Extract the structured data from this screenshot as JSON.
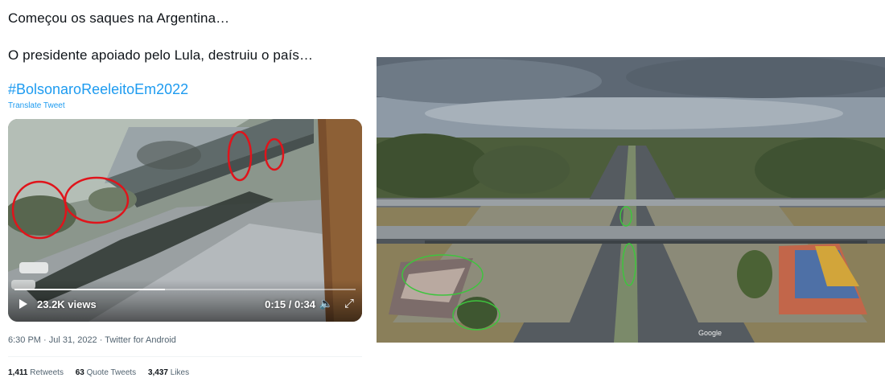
{
  "tweet": {
    "line1": "Começou os saques na Argentina…",
    "line2": "O presidente apoiado pelo Lula, destruiu o país…",
    "hashtag": "#BolsonaroReeleitoEm2022",
    "translate": "Translate Tweet",
    "timestamp": "6:30 PM · Jul 31, 2022 · Twitter for Android"
  },
  "video": {
    "views": "23.2K views",
    "time": "0:15 / 0:34",
    "progress": 0.44,
    "play_icon": "play-icon",
    "volume_icon": "volume-icon",
    "expand_icon": "expand-icon",
    "volume_glyph": "🔈",
    "expand_glyph": "⤢"
  },
  "stats": {
    "retweets_count": "1,411",
    "retweets_label": "Retweets",
    "quotes_count": "63",
    "quotes_label": "Quote Tweets",
    "likes_count": "3,437",
    "likes_label": "Likes"
  },
  "aerial": {
    "watermark": "Google"
  },
  "colors": {
    "link": "#1d9bf0",
    "annotation_red": "#e0141b",
    "annotation_green": "#3ec43e"
  }
}
